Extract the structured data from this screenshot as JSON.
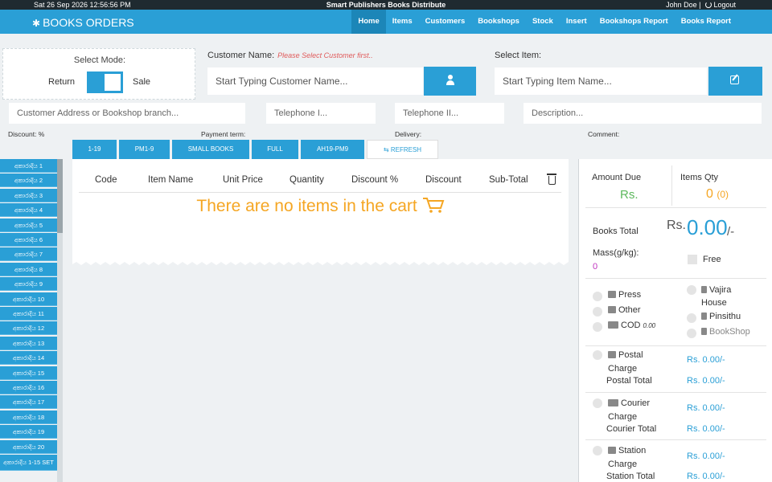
{
  "topbar": {
    "datetime": "Sat 26 Sep 2026 12:56:56 PM",
    "company": "Smart Publishers Books Distribute",
    "user": "John Doe |",
    "logout": "Logout"
  },
  "navbar": {
    "brand": "BOOKS ORDERS",
    "items": [
      "Home",
      "Items",
      "Customers",
      "Bookshops",
      "Stock",
      "Insert",
      "Bookshops Report",
      "Books Report"
    ]
  },
  "mode": {
    "title": "Select Mode:",
    "return": "Return",
    "sale": "Sale"
  },
  "customer": {
    "label": "Customer Name:",
    "warning": "Please Select Customer first..",
    "placeholder": "Start Typing Customer Name..."
  },
  "item": {
    "label": "Select Item:",
    "placeholder": "Start Typing Item Name..."
  },
  "fields": {
    "address": "Customer Address or Bookshop branch...",
    "tel1": "Telephone I...",
    "tel2": "Telephone II...",
    "description": "Description..."
  },
  "labels": {
    "discount": "Discount: %",
    "payment": "Payment term:",
    "delivery": "Delivery:",
    "comment": "Comment:"
  },
  "price_tabs": [
    "1-19",
    "PM1-9",
    "SMALL BOOKS",
    "FULL",
    "AH19-PM9",
    "REFRESH"
  ],
  "sidebar_items": [
    "අකාරාදිය 1",
    "අකාරාදිය 2",
    "අකාරාදිය 3",
    "අකාරාදිය 4",
    "අකාරාදිය 5",
    "අකාරාදිය 6",
    "අකාරාදිය 7",
    "අකාරාදිය 8",
    "අකාරාදිය 9",
    "අකාරාදිය 10",
    "අකාරාදිය 11",
    "අකාරාදිය 12",
    "අකාරාදිය 13",
    "අකාරාදිය 14",
    "අකාරාදිය 15",
    "අකාරාදිය 16",
    "අකාරාදිය 17",
    "අකාරාදිය 18",
    "අකාරාදිය 19",
    "අකාරාදිය 20",
    "අකාරාදිය 1-15 SET"
  ],
  "cart": {
    "columns": [
      "Code",
      "Item Name",
      "Unit Price",
      "Quantity",
      "Discount %",
      "Discount",
      "Sub-Total"
    ],
    "empty": "There are no items in the cart"
  },
  "summary": {
    "amount_due_label": "Amount Due",
    "amount_due_value": "Rs.",
    "items_qty_label": "Items Qty",
    "items_qty_value": "0",
    "items_qty_sub": "(0)",
    "books_total_label": "Books Total",
    "books_total_rs": "Rs.",
    "books_total_value": "0.00",
    "books_total_suffix": "/-",
    "mass_label": "Mass(g/kg):",
    "mass_value": "0",
    "free_label": "Free",
    "press": "Press",
    "other": "Other",
    "cod": "COD",
    "cod_value": "0.00",
    "vajira": "Vajira House",
    "pinsithu": "Pinsithu",
    "bookshop": "BookShop",
    "postal_charge": "Postal Charge",
    "postal_total": "Postal Total",
    "courier_charge": "Courier Charge",
    "courier_total": "Courier Total",
    "station_charge": "Station Charge",
    "station_total": "Station Total",
    "zero_rs": "Rs. 0.00/-"
  }
}
